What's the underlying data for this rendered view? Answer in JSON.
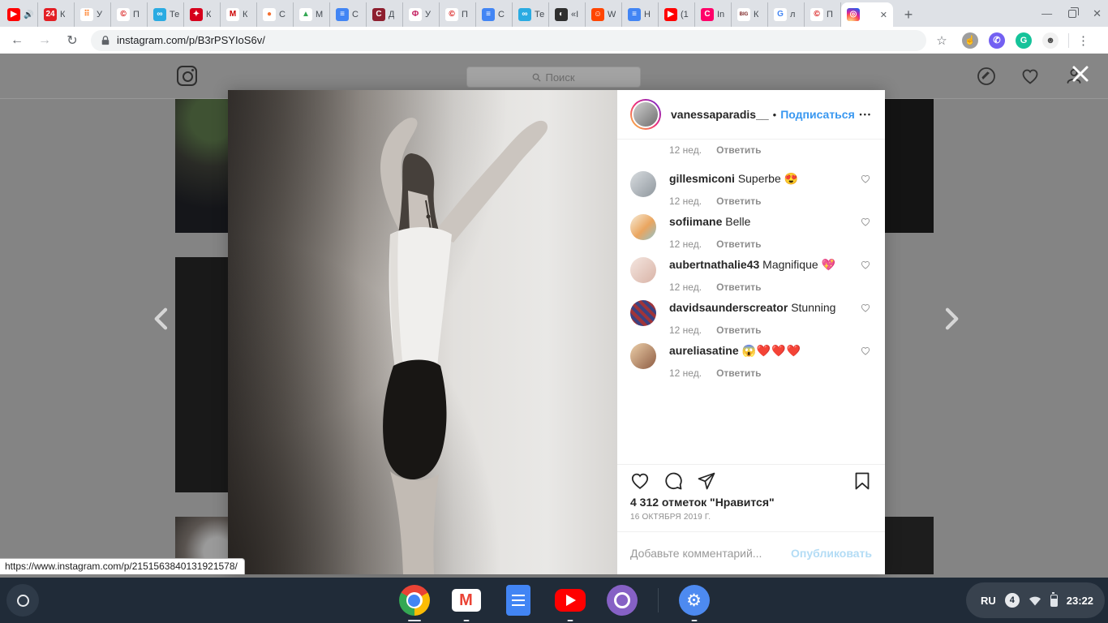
{
  "browser": {
    "tabs": [
      {
        "label": "",
        "audio": "🔊",
        "fav": {
          "bg": "#ff0000",
          "fg": "#ffffff",
          "glyph": "▶",
          "name": "youtube"
        }
      },
      {
        "label": "К",
        "fav": {
          "bg": "#e31e24",
          "fg": "#ffffff",
          "glyph": "24",
          "name": "24-news"
        }
      },
      {
        "label": "У",
        "fav": {
          "bg": "#ffffff",
          "fg": "#ff7f27",
          "glyph": "⠿",
          "name": "orange-dots"
        }
      },
      {
        "label": "П",
        "fav": {
          "bg": "#ffffff",
          "fg": "#d40000",
          "glyph": "©",
          "name": "copyright-red"
        }
      },
      {
        "label": "Те",
        "fav": {
          "bg": "#2aabe2",
          "fg": "#ffffff",
          "glyph": "∞",
          "name": "blue-circle"
        }
      },
      {
        "label": "К",
        "fav": {
          "bg": "#d6001c",
          "fg": "#ffffff",
          "glyph": "✦",
          "name": "red-circle"
        }
      },
      {
        "label": "К",
        "fav": {
          "bg": "#ffffff",
          "fg": "#cc0000",
          "glyph": "М",
          "name": "m-red"
        }
      },
      {
        "label": "С",
        "fav": {
          "bg": "#ffffff",
          "fg": "#f46f30",
          "glyph": "●",
          "name": "fox"
        }
      },
      {
        "label": "М",
        "fav": {
          "bg": "#ffffff",
          "fg": "#34a853",
          "glyph": "▲",
          "name": "google-drive"
        }
      },
      {
        "label": "С",
        "fav": {
          "bg": "#4285f4",
          "fg": "#ffffff",
          "glyph": "≡",
          "name": "google-docs"
        }
      },
      {
        "label": "Д",
        "fav": {
          "bg": "#8e1f2f",
          "fg": "#ffffff",
          "glyph": "С",
          "name": "dark-red-c"
        }
      },
      {
        "label": "У",
        "fav": {
          "bg": "#ffffff",
          "fg": "#c2185b",
          "glyph": "Ф",
          "name": "magenta-f"
        }
      },
      {
        "label": "П",
        "fav": {
          "bg": "#ffffff",
          "fg": "#d40000",
          "glyph": "©",
          "name": "copyright-red"
        }
      },
      {
        "label": "С",
        "fav": {
          "bg": "#4285f4",
          "fg": "#ffffff",
          "glyph": "≡",
          "name": "google-docs"
        }
      },
      {
        "label": "Те",
        "fav": {
          "bg": "#2aabe2",
          "fg": "#ffffff",
          "glyph": "∞",
          "name": "blue-circle"
        }
      },
      {
        "label": "«I",
        "fav": {
          "bg": "#2f2f2f",
          "fg": "#ffffff",
          "glyph": "◐",
          "name": "panda"
        }
      },
      {
        "label": "W",
        "fav": {
          "bg": "#ff4500",
          "fg": "#ffffff",
          "glyph": "☺",
          "name": "reddit"
        }
      },
      {
        "label": "Н",
        "fav": {
          "bg": "#4285f4",
          "fg": "#ffffff",
          "glyph": "≡",
          "name": "google-docs"
        }
      },
      {
        "label": "(1",
        "fav": {
          "bg": "#ff0000",
          "fg": "#ffffff",
          "glyph": "▶",
          "name": "youtube"
        }
      },
      {
        "label": "In",
        "fav": {
          "bg": "#ff0069",
          "fg": "#ffffff",
          "glyph": "C",
          "name": "pink-c"
        }
      },
      {
        "label": "К",
        "fav": {
          "bg": "#ffffff",
          "fg": "#7a1f1f",
          "glyph": "BIG",
          "fav_class": "tiny",
          "name": "big-picture"
        }
      },
      {
        "label": "л",
        "fav": {
          "bg": "#ffffff",
          "fg": "#4285f4",
          "glyph": "G",
          "name": "google"
        }
      },
      {
        "label": "П",
        "fav": {
          "bg": "#ffffff",
          "fg": "#d40000",
          "glyph": "©",
          "name": "copyright-red"
        }
      },
      {
        "label": "",
        "active": "active",
        "close": "✕",
        "fav": {
          "bg": "radial-gradient(circle at 30% 110%,#fdf497 0%,#fd5949 45%,#d6249f 60%,#285AEB 90%)",
          "fg": "#ffffff",
          "glyph": "◎",
          "name": "instagram"
        }
      }
    ],
    "new_tab_label": "+",
    "window_controls": {
      "minimize": "—",
      "close": "✕"
    },
    "nav": {
      "back": "←",
      "forward": "→",
      "reload": "↻"
    },
    "address": {
      "url": "instagram.com/p/B3rPSYIoS6v/"
    },
    "bookmark_star": "☆",
    "extensions": [
      {
        "name": "pointer-extension",
        "bg": "#9e9e9e",
        "fg": "#ffffff",
        "glyph": "☝"
      },
      {
        "name": "viber",
        "bg": "#7360f2",
        "fg": "#ffffff",
        "glyph": "✆"
      },
      {
        "name": "grammarly",
        "bg": "#15c39a",
        "fg": "#ffffff",
        "glyph": "G"
      },
      {
        "name": "ghostery",
        "bg": "#f1f1f1",
        "fg": "#4a4a4a",
        "glyph": "☻"
      }
    ],
    "menu_dots": "⋮"
  },
  "instagram": {
    "header": {
      "search_placeholder": "Поиск"
    },
    "post": {
      "username": "vanessaparadis__",
      "separator_dot": "•",
      "follow_label": "Подписаться",
      "menu": "•••",
      "avatar_bg": "linear-gradient(135deg,#cfcfcf,#6f6f6f)",
      "clipped_meta": {
        "time": "12 нед.",
        "reply": "Ответить"
      },
      "likes": "4 312 отметок \"Нравится\"",
      "date": "16 ОКТЯБРЯ 2019 Г.",
      "comment_placeholder": "Добавьте комментарий...",
      "post_button": "Опубликовать"
    },
    "comments": [
      {
        "user": "gillesmiconi",
        "text": "Superbe",
        "emoji": "😍",
        "time": "12 нед.",
        "reply": "Ответить",
        "avatar": "linear-gradient(135deg,#d8dcdf,#8f979e)"
      },
      {
        "user": "sofiimane",
        "text": "Belle",
        "emoji": "",
        "time": "12 нед.",
        "reply": "Ответить",
        "avatar": "linear-gradient(135deg,#f6ecd8,#eaa55f 55%,#8fc3cd)"
      },
      {
        "user": "aubertnathalie43",
        "text": "Magnifique",
        "emoji": "💖",
        "time": "12 нед.",
        "reply": "Ответить",
        "avatar": "linear-gradient(135deg,#f4e6e0,#d9b3a6)"
      },
      {
        "user": "davidsaunderscreator",
        "text": "Stunning",
        "emoji": "",
        "time": "12 нед.",
        "reply": "Ответить",
        "avatar": "repeating-linear-gradient(45deg,#3c4280 0 4px,#a03439 4px 8px)"
      },
      {
        "user": "aureliasatine",
        "text": "",
        "emoji": "😱❤️❤️❤️",
        "time": "12 нед.",
        "reply": "Ответить",
        "avatar": "linear-gradient(135deg,#eccfa9,#8e5c43)"
      }
    ],
    "link_preview": "https://www.instagram.com/p/2151563840131921578/"
  },
  "shelf": {
    "apps": [
      {
        "name": "chrome",
        "indicator": "wide"
      },
      {
        "name": "gmail",
        "indicator": "small"
      },
      {
        "name": "docs",
        "indicator": "none"
      },
      {
        "name": "youtube",
        "indicator": "small"
      },
      {
        "name": "circle-app",
        "indicator": "none"
      },
      {
        "name": "separator",
        "indicator": "none"
      },
      {
        "name": "settings",
        "indicator": "small"
      }
    ],
    "status": {
      "lang": "RU",
      "notifications": "4",
      "time": "23:22"
    }
  }
}
